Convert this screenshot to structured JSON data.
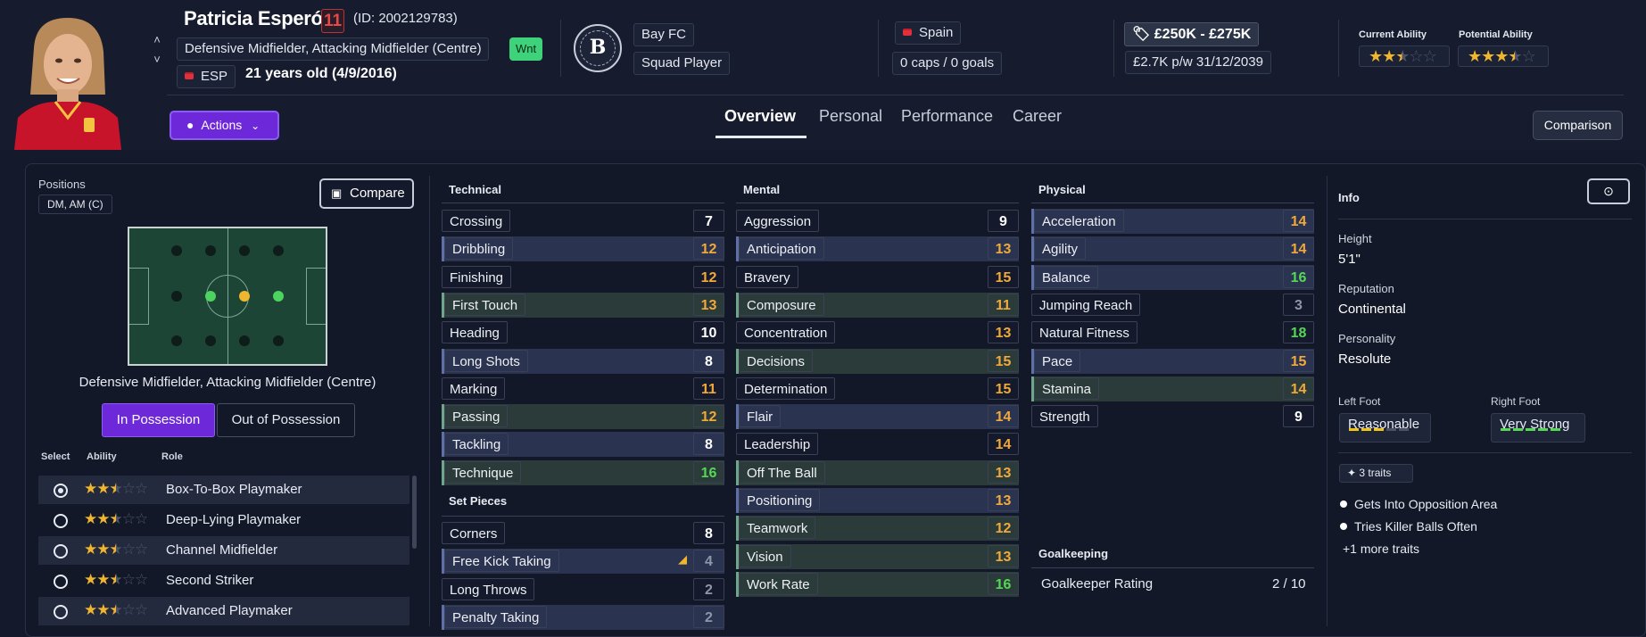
{
  "player": {
    "name": "Patricia Esperón",
    "shirt_number": "11",
    "id_text": "(ID: 2002129783)",
    "positions": "Defensive Midfielder, Attacking Midfielder (Centre)",
    "wnt_badge": "Wnt",
    "nation_code": "ESP",
    "age_text": "21 years old (4/9/2016)"
  },
  "club": {
    "badge_initials": "B",
    "name": "Bay FC",
    "status": "Squad Player"
  },
  "nation": {
    "name": "Spain",
    "caps": "0 caps / 0 goals"
  },
  "contract": {
    "value": "£250K - £275K",
    "wage": "£2.7K p/w 31/12/2039"
  },
  "ability": {
    "current_label": "Current Ability",
    "current_stars": 2.5,
    "potential_label": "Potential Ability",
    "potential_stars": 3.5
  },
  "nav": {
    "actions_label": "Actions",
    "tabs": [
      "Overview",
      "Personal",
      "Performance",
      "Career"
    ],
    "active_tab": "Overview",
    "comparison_label": "Comparison"
  },
  "positions_panel": {
    "title": "Positions",
    "positions_chip": "DM, AM (C)",
    "compare_label": "Compare",
    "role_caption": "Defensive Midfielder, Attacking Midfielder (Centre)",
    "in_possession": "In Possession",
    "out_of_possession": "Out of Possession",
    "headers": {
      "select": "Select",
      "ability": "Ability",
      "role": "Role"
    },
    "roles": [
      {
        "name": "Box-To-Box Playmaker",
        "stars": 2.5,
        "selected": true
      },
      {
        "name": "Deep-Lying Playmaker",
        "stars": 2.5,
        "selected": false
      },
      {
        "name": "Channel Midfielder",
        "stars": 2.5,
        "selected": false
      },
      {
        "name": "Second Striker",
        "stars": 2.5,
        "selected": false
      },
      {
        "name": "Advanced Playmaker",
        "stars": 2.5,
        "selected": false
      }
    ]
  },
  "technical": {
    "title": "Technical",
    "rows": [
      {
        "name": "Crossing",
        "value": "7",
        "tone": "w",
        "hl": ""
      },
      {
        "name": "Dribbling",
        "value": "12",
        "tone": "o",
        "hl": "b"
      },
      {
        "name": "Finishing",
        "value": "12",
        "tone": "o",
        "hl": ""
      },
      {
        "name": "First Touch",
        "value": "13",
        "tone": "o",
        "hl": "g"
      },
      {
        "name": "Heading",
        "value": "10",
        "tone": "w",
        "hl": ""
      },
      {
        "name": "Long Shots",
        "value": "8",
        "tone": "w",
        "hl": "b"
      },
      {
        "name": "Marking",
        "value": "11",
        "tone": "o",
        "hl": ""
      },
      {
        "name": "Passing",
        "value": "12",
        "tone": "o",
        "hl": "g"
      },
      {
        "name": "Tackling",
        "value": "8",
        "tone": "w",
        "hl": "b"
      },
      {
        "name": "Technique",
        "value": "16",
        "tone": "g",
        "hl": "g"
      }
    ]
  },
  "set_pieces": {
    "title": "Set Pieces",
    "rows": [
      {
        "name": "Corners",
        "value": "8",
        "tone": "w",
        "hl": ""
      },
      {
        "name": "Free Kick Taking",
        "value": "4",
        "tone": "d",
        "hl": "b"
      },
      {
        "name": "Long Throws",
        "value": "2",
        "tone": "d",
        "hl": ""
      },
      {
        "name": "Penalty Taking",
        "value": "2",
        "tone": "d",
        "hl": "b"
      }
    ]
  },
  "mental": {
    "title": "Mental",
    "rows": [
      {
        "name": "Aggression",
        "value": "9",
        "tone": "w",
        "hl": ""
      },
      {
        "name": "Anticipation",
        "value": "13",
        "tone": "o",
        "hl": "b"
      },
      {
        "name": "Bravery",
        "value": "15",
        "tone": "o",
        "hl": ""
      },
      {
        "name": "Composure",
        "value": "11",
        "tone": "o",
        "hl": "g"
      },
      {
        "name": "Concentration",
        "value": "13",
        "tone": "o",
        "hl": ""
      },
      {
        "name": "Decisions",
        "value": "15",
        "tone": "o",
        "hl": "g"
      },
      {
        "name": "Determination",
        "value": "15",
        "tone": "o",
        "hl": ""
      },
      {
        "name": "Flair",
        "value": "14",
        "tone": "o",
        "hl": "b"
      },
      {
        "name": "Leadership",
        "value": "14",
        "tone": "o",
        "hl": ""
      },
      {
        "name": "Off The Ball",
        "value": "13",
        "tone": "o",
        "hl": "g"
      },
      {
        "name": "Positioning",
        "value": "13",
        "tone": "o",
        "hl": "b"
      },
      {
        "name": "Teamwork",
        "value": "12",
        "tone": "o",
        "hl": "g"
      },
      {
        "name": "Vision",
        "value": "13",
        "tone": "o",
        "hl": "g"
      },
      {
        "name": "Work Rate",
        "value": "16",
        "tone": "g",
        "hl": "g"
      }
    ]
  },
  "physical": {
    "title": "Physical",
    "rows": [
      {
        "name": "Acceleration",
        "value": "14",
        "tone": "o",
        "hl": "b"
      },
      {
        "name": "Agility",
        "value": "14",
        "tone": "o",
        "hl": "b"
      },
      {
        "name": "Balance",
        "value": "16",
        "tone": "g",
        "hl": "b"
      },
      {
        "name": "Jumping Reach",
        "value": "3",
        "tone": "d",
        "hl": ""
      },
      {
        "name": "Natural Fitness",
        "value": "18",
        "tone": "g",
        "hl": ""
      },
      {
        "name": "Pace",
        "value": "15",
        "tone": "o",
        "hl": "b"
      },
      {
        "name": "Stamina",
        "value": "14",
        "tone": "o",
        "hl": "g"
      },
      {
        "name": "Strength",
        "value": "9",
        "tone": "w",
        "hl": ""
      }
    ]
  },
  "goalkeeping": {
    "title": "Goalkeeping",
    "rating_label": "Goalkeeper Rating",
    "rating_value": "2 / 10"
  },
  "info": {
    "title": "Info",
    "height_label": "Height",
    "height": "5'1\"",
    "reputation_label": "Reputation",
    "reputation": "Continental",
    "personality_label": "Personality",
    "personality": "Resolute",
    "left_foot_label": "Left Foot",
    "left_foot": "Reasonable",
    "left_foot_level": 3,
    "right_foot_label": "Right Foot",
    "right_foot": "Very Strong",
    "right_foot_level": 5,
    "traits_chip": "3 traits",
    "traits": [
      "Gets Into Opposition Area",
      "Tries Killer Balls Often"
    ],
    "more_traits": "+1 more traits"
  },
  "colors": {
    "accent_purple": "#6d28d9",
    "high": "#54d855",
    "mid": "#f2a93b",
    "low": "#8f96a8",
    "star": "#f0b62e"
  }
}
